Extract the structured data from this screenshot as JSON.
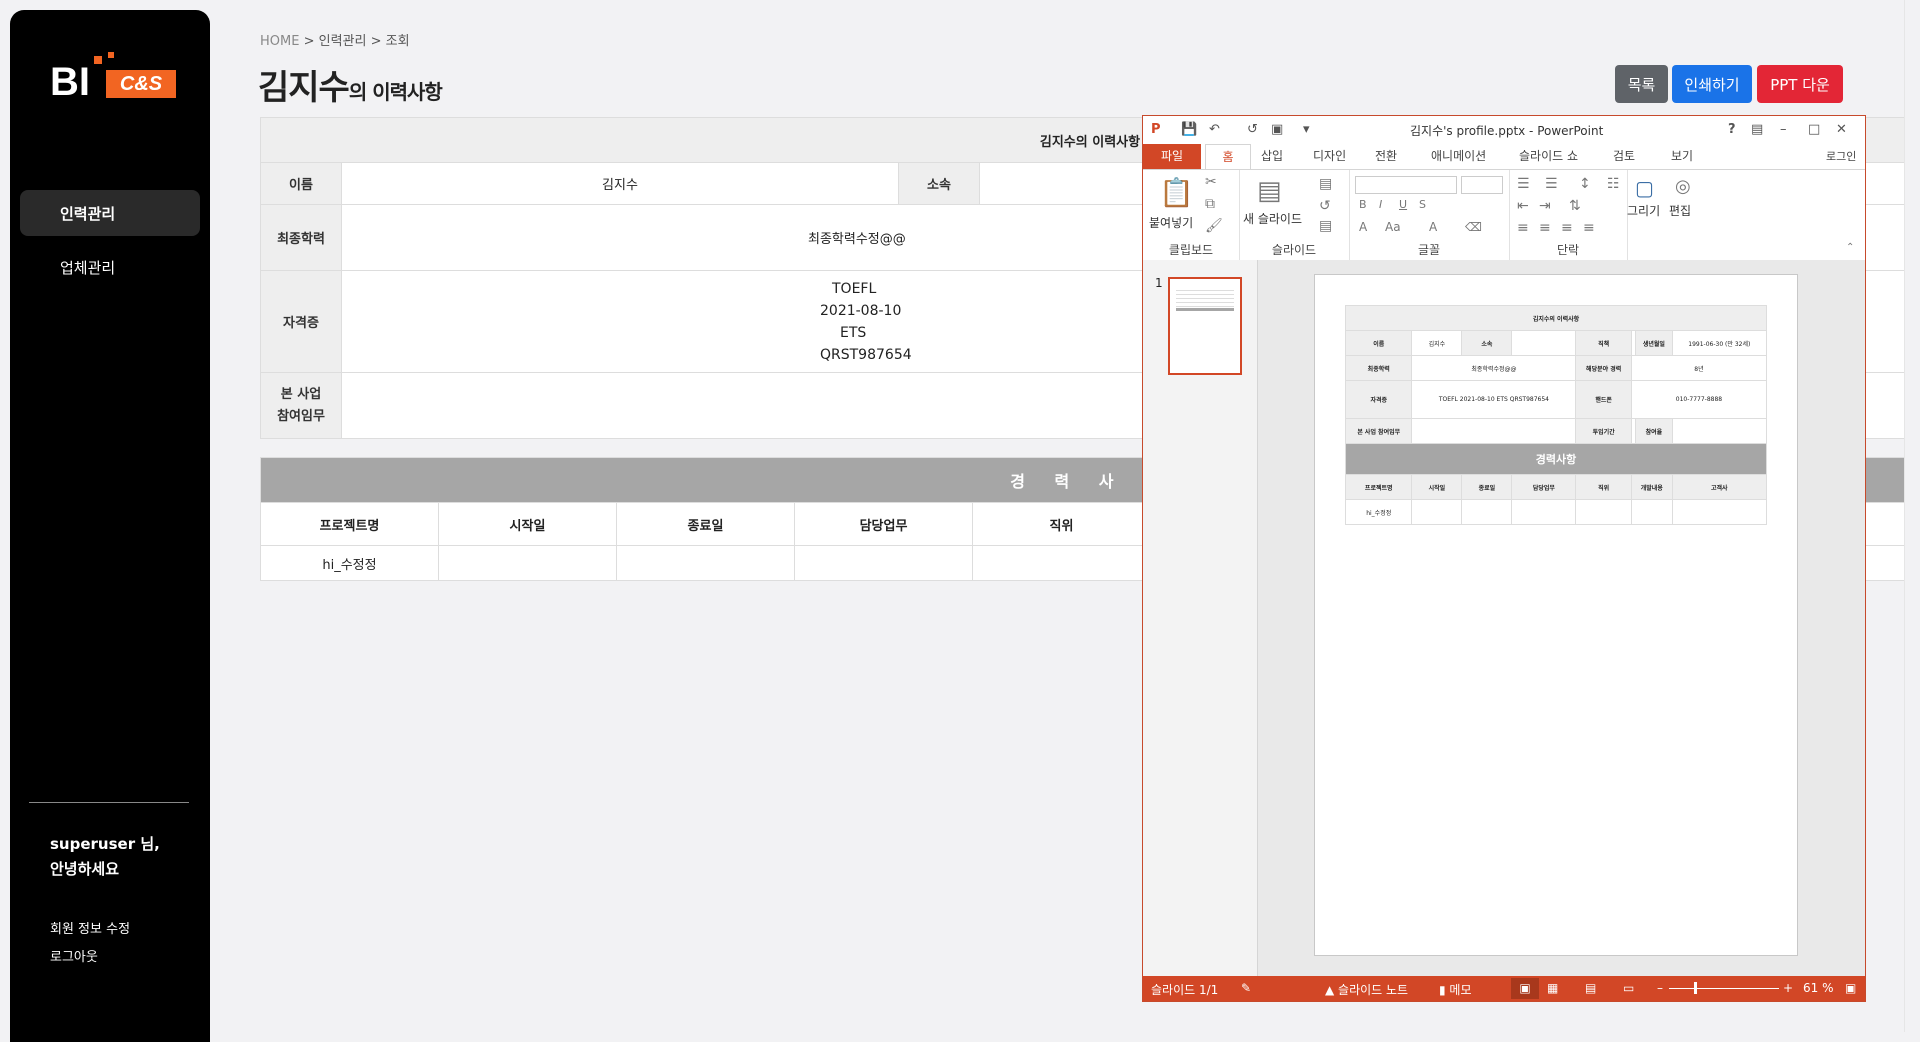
{
  "sidebar": {
    "logo_bi": "BI",
    "logo_cs": "C&S",
    "nav": [
      "인력관리",
      "업체관리"
    ],
    "greeting_line1": "superuser 님,",
    "greeting_line2": "안녕하세요",
    "links": [
      "회원 정보 수정",
      "로그아웃"
    ]
  },
  "breadcrumb": {
    "home": "HOME",
    "sep1": " > ",
    "level1": "인력관리",
    "sep2": " > ",
    "level2": "조회"
  },
  "page_title": {
    "name": "김지수",
    "suffix": "의 이력사항"
  },
  "buttons": {
    "list": "목록",
    "print": "인쇄하기",
    "ppt": "PPT 다운"
  },
  "colors": {
    "list": "#5f6368",
    "print": "#1a73e8",
    "ppt": "#e32636",
    "ppt_accent": "#d24726"
  },
  "info_table": {
    "caption": "김지수의 이력사항",
    "name_label": "이름",
    "name_value": "김지수",
    "dept_label": "소속",
    "edu_label": "최종학력",
    "edu_value": "최종학력수정@@",
    "cert_label": "자격증",
    "cert_lines": [
      "TOEFL",
      "2021-08-10",
      "ETS",
      "QRST987654"
    ],
    "role_label_1": "본 사업",
    "role_label_2": "참여임무"
  },
  "career_table": {
    "title": "경 력 사 항",
    "headers": [
      "프로젝트명",
      "시작일",
      "종료일",
      "담당업무",
      "직위"
    ],
    "rows": [
      [
        "hi_수정정",
        "",
        "",
        "",
        ""
      ]
    ]
  },
  "ppt": {
    "title": "김지수's profile.pptx - PowerPoint",
    "tabs": [
      "파일",
      "홈",
      "삽입",
      "디자인",
      "전환",
      "애니메이션",
      "슬라이드 쇼",
      "검토",
      "보기"
    ],
    "login": "로그인",
    "groups": {
      "clipboard": "클립보드",
      "slides": "슬라이드",
      "font": "글꼴",
      "paragraph": "단락"
    },
    "paste": "붙여넣기",
    "new_slide": "새 슬라이드",
    "draw": "그리기",
    "edit": "편집",
    "slide_number": "1",
    "status": {
      "slide": "슬라이드 1/1",
      "notes": "슬라이드 노트",
      "memo": "메모",
      "zoom": "61 %"
    },
    "mini": {
      "caption": "김지수의 이력사항",
      "r1": [
        "이름",
        "김지수",
        "소속",
        "",
        "직책",
        "",
        "생년월일",
        "1991-06-30 (만 32세)"
      ],
      "r2": [
        "최종학력",
        "최종학력수정@@",
        "해당분야 경력",
        "8년"
      ],
      "r3": [
        "자격증",
        "TOEFL 2021-08-10 ETS QRST987654",
        "핸드폰",
        "010-7777-8888"
      ],
      "r4": [
        "본 사업 참여임무",
        "",
        "투입기간",
        "",
        "참여율",
        ""
      ],
      "band": "경력사항",
      "headers": [
        "프로젝트명",
        "시작일",
        "종료일",
        "담당업무",
        "직위",
        "개발내용",
        "고객사"
      ],
      "row": [
        "hi_수정정",
        "",
        "",
        "",
        "",
        "",
        ""
      ]
    }
  }
}
